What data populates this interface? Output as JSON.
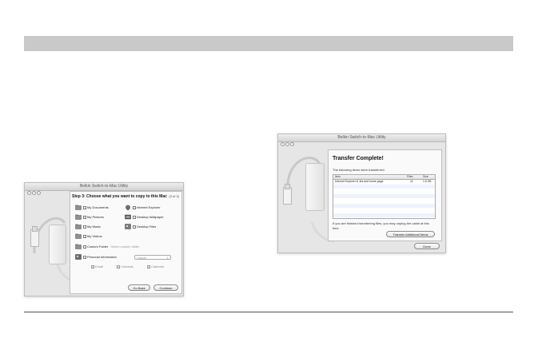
{
  "step3_window": {
    "title": "Belkin Switch-to-Mac Utility",
    "heading": "Step 3: Choose what you want to copy to this Mac",
    "page_indicator": "(3 of 3)",
    "options_left": [
      {
        "label": "My Documents",
        "icon": "documents-folder-icon"
      },
      {
        "label": "My Pictures",
        "icon": "pictures-folder-icon"
      },
      {
        "label": "My Music",
        "icon": "music-folder-icon"
      },
      {
        "label": "My Videos",
        "icon": "videos-folder-icon"
      }
    ],
    "options_right": [
      {
        "label": "Internet Explorer",
        "icon": "internet-explorer-icon"
      },
      {
        "label": "Desktop Wallpaper",
        "icon": "wallpaper-icon"
      },
      {
        "label": "Desktop Files",
        "icon": "desktop-files-icon"
      }
    ],
    "custom_folder": {
      "label": "Custom Folder",
      "placeholder": "Select custom folder"
    },
    "personal_info": {
      "label": "Personal Information",
      "popup": "Outlook"
    },
    "personal_items": [
      "Email",
      "Contacts",
      "Calendar"
    ],
    "buttons": {
      "back": "Go Back",
      "continue": "Continue"
    }
  },
  "transfer_window": {
    "title": "Belkin Switch-to-Mac Utility",
    "heading": "Transfer Complete!",
    "subtitle": "The following items were transferred:",
    "columns": [
      "Item",
      "Files",
      "Size"
    ],
    "rows": [
      {
        "item": "Internet Explorer 6 .ibs and home page",
        "files": "11",
        "size": "1.6 KB"
      }
    ],
    "message": "If you are finished transferring files, you may unplug the cable at this time.",
    "buttons": {
      "transfer_more": "Transfer Additional Items",
      "done": "Done"
    }
  }
}
